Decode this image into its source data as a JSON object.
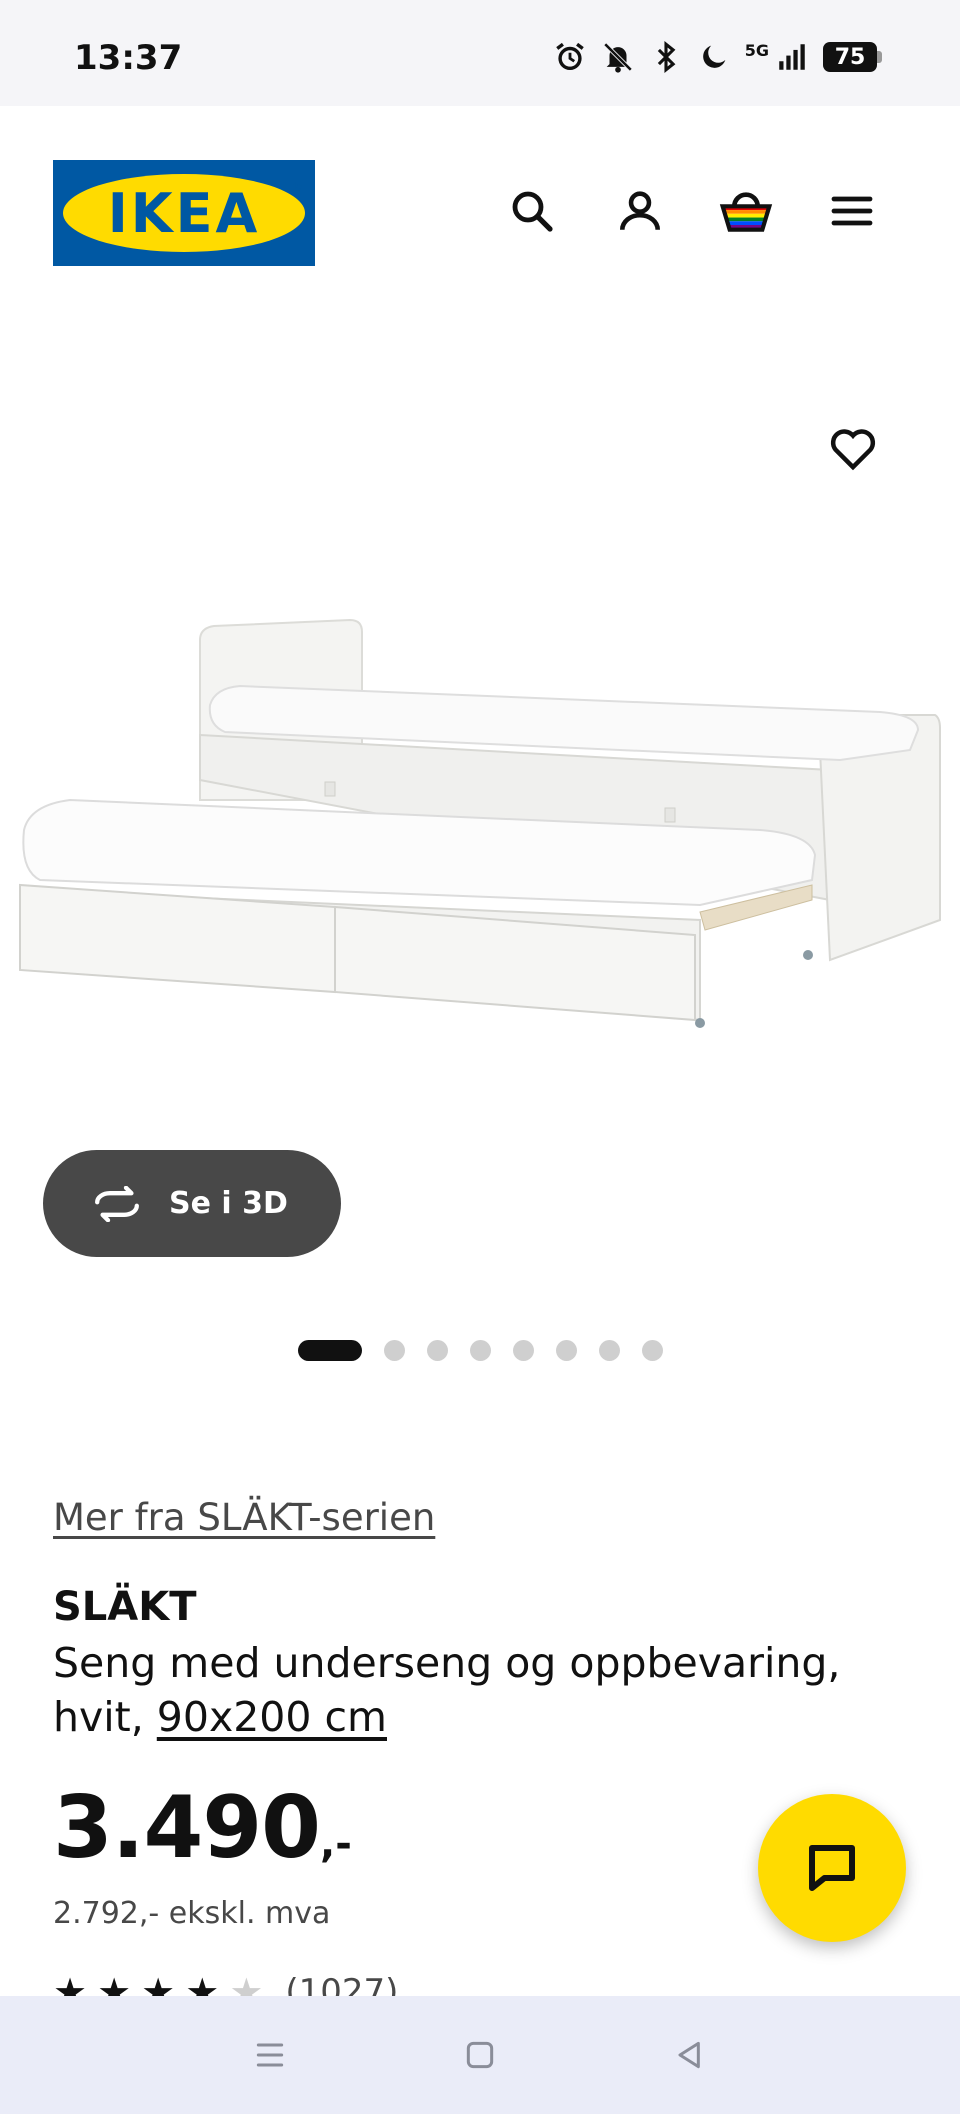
{
  "status_bar": {
    "time": "13:37",
    "network": "5G",
    "battery": "75",
    "icons": [
      "alarm-icon",
      "mute-icon",
      "bluetooth-icon",
      "moon-icon",
      "signal-icon"
    ]
  },
  "header": {
    "logo_text": "IKEA",
    "logo_colors": {
      "blue": "#0058a3",
      "yellow": "#ffdb00"
    },
    "icons": [
      "search-icon",
      "user-icon",
      "shopping-bag-icon",
      "menu-icon"
    ]
  },
  "gallery": {
    "view_3d_label": "Se i 3D",
    "image_count": 8,
    "active_index": 0
  },
  "product": {
    "series_link": "Mer fra SLÄKT-serien",
    "name": "SLÄKT",
    "description": "Seng med underseng og oppbevaring, hvit, ",
    "size": "90x200 cm",
    "price": "3.490",
    "price_suffix": ",-",
    "price_excl_vat": "2.792,- ekskl. mva",
    "rating": 4,
    "rating_count": "(1027)"
  },
  "colors": {
    "accent_yellow": "#ffdb00",
    "dark_button": "#484848"
  },
  "nav": {
    "buttons": [
      "recent-apps-icon",
      "home-icon",
      "back-icon"
    ]
  }
}
